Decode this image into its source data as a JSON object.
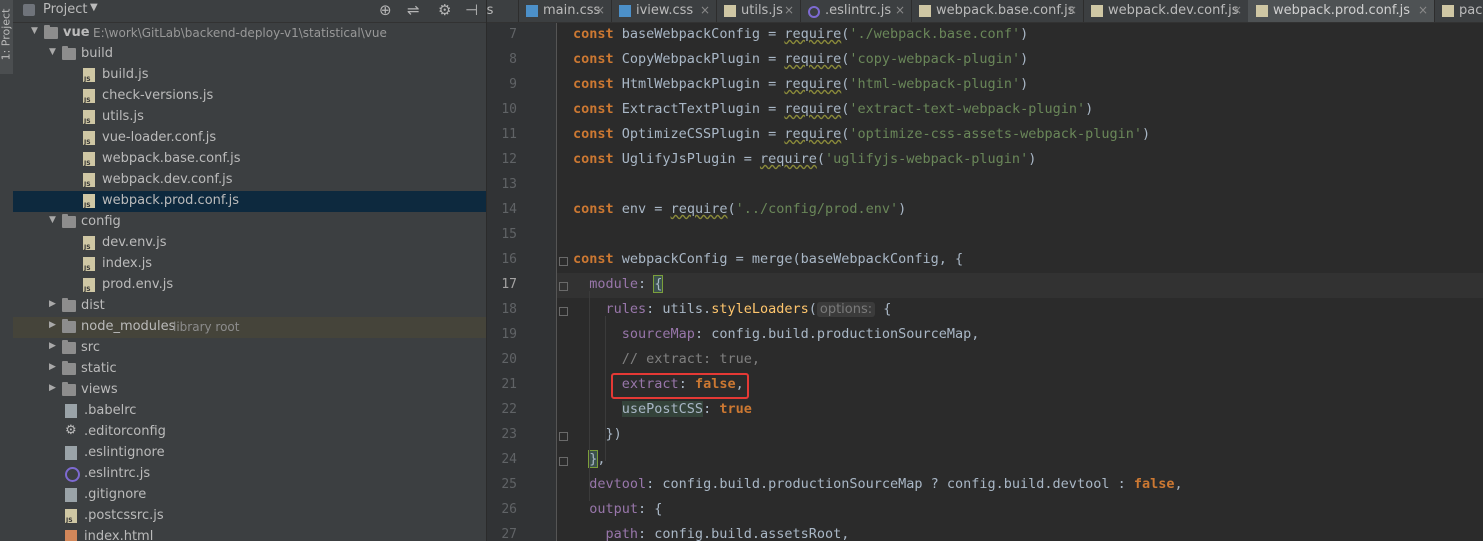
{
  "sidebar_stripe": {
    "label": "1: Project"
  },
  "project_panel": {
    "title": "Project",
    "dropdown_glyph": "▼",
    "header_icons": [
      "target-icon",
      "collapse-icon",
      "gear-icon",
      "hide-icon"
    ],
    "header_glyphs": {
      "target": "⊕",
      "collapse": "⇌",
      "gear": "⚙",
      "hide": "⊣"
    },
    "tree": [
      {
        "label": "vue",
        "path": "E:\\work\\GitLab\\backend-deploy-v1\\statistical\\vue",
        "type": "folder",
        "depth": 0,
        "expanded": true
      },
      {
        "label": "build",
        "type": "folder",
        "depth": 1,
        "expanded": true
      },
      {
        "label": "build.js",
        "type": "js",
        "depth": 2
      },
      {
        "label": "check-versions.js",
        "type": "js",
        "depth": 2
      },
      {
        "label": "utils.js",
        "type": "js",
        "depth": 2
      },
      {
        "label": "vue-loader.conf.js",
        "type": "js",
        "depth": 2
      },
      {
        "label": "webpack.base.conf.js",
        "type": "js",
        "depth": 2
      },
      {
        "label": "webpack.dev.conf.js",
        "type": "js",
        "depth": 2
      },
      {
        "label": "webpack.prod.conf.js",
        "type": "js",
        "depth": 2,
        "selected": true
      },
      {
        "label": "config",
        "type": "folder",
        "depth": 1,
        "expanded": true
      },
      {
        "label": "dev.env.js",
        "type": "js",
        "depth": 2
      },
      {
        "label": "index.js",
        "type": "js",
        "depth": 2
      },
      {
        "label": "prod.env.js",
        "type": "js",
        "depth": 2
      },
      {
        "label": "dist",
        "type": "folder",
        "depth": 1,
        "expanded": false
      },
      {
        "label": "node_modules",
        "type": "folder",
        "depth": 1,
        "expanded": false,
        "library": "library root"
      },
      {
        "label": "src",
        "type": "folder",
        "depth": 1,
        "expanded": false
      },
      {
        "label": "static",
        "type": "folder",
        "depth": 1,
        "expanded": false
      },
      {
        "label": "views",
        "type": "folder",
        "depth": 1,
        "expanded": false
      },
      {
        "label": ".babelrc",
        "type": "cfg",
        "depth": 1
      },
      {
        "label": ".editorconfig",
        "type": "gear",
        "depth": 1
      },
      {
        "label": ".eslintignore",
        "type": "cfg",
        "depth": 1
      },
      {
        "label": ".eslintrc.js",
        "type": "esl",
        "depth": 1
      },
      {
        "label": ".gitignore",
        "type": "cfg",
        "depth": 1
      },
      {
        "label": ".postcssrc.js",
        "type": "js",
        "depth": 1
      },
      {
        "label": "index.html",
        "type": "html",
        "depth": 1
      }
    ]
  },
  "tabs": [
    {
      "label": "js",
      "icon": "none",
      "partial": true
    },
    {
      "label": "main.css",
      "icon": "css"
    },
    {
      "label": "iview.css",
      "icon": "css"
    },
    {
      "label": "utils.js",
      "icon": "js"
    },
    {
      "label": ".eslintrc.js",
      "icon": "esl"
    },
    {
      "label": "webpack.base.conf.js",
      "icon": "js"
    },
    {
      "label": "webpack.dev.conf.js",
      "icon": "js"
    },
    {
      "label": "webpack.prod.conf.js",
      "icon": "js",
      "active": true
    },
    {
      "label": "pack",
      "icon": "js",
      "partial": true
    }
  ],
  "tab_close_glyph": "×",
  "editor": {
    "current_line": 17,
    "highlighted_line": 21,
    "lines": [
      {
        "n": 7,
        "tokens": [
          [
            "kw",
            "const "
          ],
          [
            "obj",
            "baseWebpackConfig = "
          ],
          [
            "req",
            "require"
          ],
          [
            "obj",
            "("
          ],
          [
            "str",
            "'./webpack.base.conf'"
          ],
          [
            "obj",
            ")"
          ]
        ]
      },
      {
        "n": 8,
        "tokens": [
          [
            "kw",
            "const "
          ],
          [
            "obj",
            "CopyWebpackPlugin = "
          ],
          [
            "req",
            "require"
          ],
          [
            "obj",
            "("
          ],
          [
            "str",
            "'copy-webpack-plugin'"
          ],
          [
            "obj",
            ")"
          ]
        ]
      },
      {
        "n": 9,
        "tokens": [
          [
            "kw",
            "const "
          ],
          [
            "obj",
            "HtmlWebpackPlugin = "
          ],
          [
            "req",
            "require"
          ],
          [
            "obj",
            "("
          ],
          [
            "str",
            "'html-webpack-plugin'"
          ],
          [
            "obj",
            ")"
          ]
        ]
      },
      {
        "n": 10,
        "tokens": [
          [
            "kw",
            "const "
          ],
          [
            "obj",
            "ExtractTextPlugin = "
          ],
          [
            "req",
            "require"
          ],
          [
            "obj",
            "("
          ],
          [
            "str",
            "'extract-text-webpack-plugin'"
          ],
          [
            "obj",
            ")"
          ]
        ]
      },
      {
        "n": 11,
        "tokens": [
          [
            "kw",
            "const "
          ],
          [
            "obj",
            "OptimizeCSSPlugin = "
          ],
          [
            "req",
            "require"
          ],
          [
            "obj",
            "("
          ],
          [
            "str",
            "'optimize-css-assets-webpack-plugin'"
          ],
          [
            "obj",
            ")"
          ]
        ]
      },
      {
        "n": 12,
        "tokens": [
          [
            "kw",
            "const "
          ],
          [
            "obj",
            "UglifyJsPlugin = "
          ],
          [
            "req",
            "require"
          ],
          [
            "obj",
            "("
          ],
          [
            "str",
            "'uglifyjs-webpack-plugin'"
          ],
          [
            "obj",
            ")"
          ]
        ]
      },
      {
        "n": 13,
        "tokens": []
      },
      {
        "n": 14,
        "tokens": [
          [
            "kw",
            "const "
          ],
          [
            "obj",
            "env = "
          ],
          [
            "req",
            "require"
          ],
          [
            "obj",
            "("
          ],
          [
            "str",
            "'../config/prod.env'"
          ],
          [
            "obj",
            ")"
          ]
        ]
      },
      {
        "n": 15,
        "tokens": []
      },
      {
        "n": 16,
        "tokens": [
          [
            "kw",
            "const "
          ],
          [
            "obj",
            "webpackConfig = "
          ],
          [
            "obj",
            "merge(baseWebpackConfig, {"
          ]
        ]
      },
      {
        "n": 17,
        "tokens": [
          [
            "obj",
            "  "
          ],
          [
            "prop",
            "module"
          ],
          [
            "obj",
            ": "
          ],
          [
            "brace",
            "{"
          ]
        ]
      },
      {
        "n": 18,
        "tokens": [
          [
            "obj",
            "    "
          ],
          [
            "prop",
            "rules"
          ],
          [
            "obj",
            ": utils."
          ],
          [
            "fn",
            "styleLoaders"
          ],
          [
            "obj",
            "("
          ],
          [
            "hint",
            "options:"
          ],
          [
            "obj",
            " {"
          ]
        ]
      },
      {
        "n": 19,
        "tokens": [
          [
            "obj",
            "      "
          ],
          [
            "prop",
            "sourceMap"
          ],
          [
            "obj",
            ": config.build.productionSourceMap,"
          ]
        ]
      },
      {
        "n": 20,
        "tokens": [
          [
            "obj",
            "      "
          ],
          [
            "cmt",
            "// extract: true,"
          ]
        ]
      },
      {
        "n": 21,
        "tokens": [
          [
            "obj",
            "      "
          ],
          [
            "prop",
            "extract"
          ],
          [
            "obj",
            ": "
          ],
          [
            "kw",
            "false"
          ],
          [
            "obj",
            ","
          ]
        ]
      },
      {
        "n": 22,
        "tokens": [
          [
            "obj",
            "      "
          ],
          [
            "unused",
            "usePostCSS"
          ],
          [
            "obj",
            ": "
          ],
          [
            "kw",
            "true"
          ]
        ]
      },
      {
        "n": 23,
        "tokens": [
          [
            "obj",
            "    })"
          ]
        ]
      },
      {
        "n": 24,
        "tokens": [
          [
            "obj",
            "  "
          ],
          [
            "brace",
            "}"
          ],
          [
            "obj",
            ","
          ]
        ]
      },
      {
        "n": 25,
        "tokens": [
          [
            "obj",
            "  "
          ],
          [
            "prop",
            "devtool"
          ],
          [
            "obj",
            ": config.build.productionSourceMap ? config.build.devtool : "
          ],
          [
            "kw",
            "false"
          ],
          [
            "obj",
            ","
          ]
        ]
      },
      {
        "n": 26,
        "tokens": [
          [
            "obj",
            "  "
          ],
          [
            "prop",
            "output"
          ],
          [
            "obj",
            ": {"
          ]
        ]
      },
      {
        "n": 27,
        "tokens": [
          [
            "obj",
            "    "
          ],
          [
            "prop",
            "path"
          ],
          [
            "obj",
            ": config.build.assetsRoot,"
          ]
        ]
      }
    ]
  },
  "colors": {
    "background": "#2b2b2b",
    "panel": "#3c3f41",
    "selection": "#0d293e",
    "keyword": "#cc7832",
    "string": "#6a8759",
    "annotation_box": "#e53935"
  }
}
